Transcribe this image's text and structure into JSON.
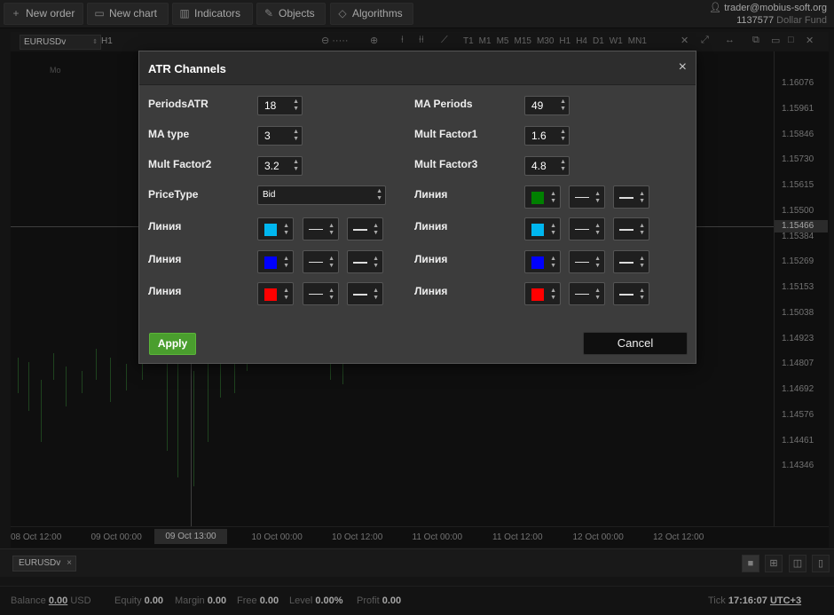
{
  "toolbar": {
    "new_order": "New order",
    "new_chart": "New chart",
    "indicators": "Indicators",
    "objects": "Objects",
    "algorithms": "Algorithms"
  },
  "account": {
    "user": "trader@mobius-soft.org",
    "number": "1137577",
    "fund": "Dollar Fund"
  },
  "chart_toolbar": {
    "symbol": "EURUSDv",
    "timeframe": "H1",
    "timeframes": [
      "T1",
      "M1",
      "M5",
      "M15",
      "M30",
      "H1",
      "H4",
      "D1",
      "W1",
      "MN1"
    ]
  },
  "chart": {
    "corner_label": "Mo",
    "y_labels": [
      "1.16076",
      "1.15961",
      "1.15846",
      "1.15730",
      "1.15615",
      "1.15500",
      "1.15384",
      "1.15269",
      "1.15153",
      "1.15038",
      "1.14923",
      "1.14807",
      "1.14692",
      "1.14576",
      "1.14461",
      "1.14346"
    ],
    "current_price": "1.15466",
    "x_labels": [
      "08 Oct 12:00",
      "09 Oct 00:00",
      "09 Oct 13:00",
      "10 Oct 00:00",
      "10 Oct 12:00",
      "11 Oct 00:00",
      "11 Oct 12:00",
      "12 Oct 00:00",
      "12 Oct 12:00"
    ]
  },
  "dialog": {
    "title": "ATR Channels",
    "close": "×",
    "fields": {
      "periods_atr": {
        "label": "PeriodsATR",
        "value": "18"
      },
      "ma_type": {
        "label": "MA type",
        "value": "3"
      },
      "mult_factor2": {
        "label": "Mult Factor2",
        "value": "3.2"
      },
      "price_type": {
        "label": "PriceType",
        "value": "Bid"
      },
      "ma_periods": {
        "label": "MA Periods",
        "value": "49"
      },
      "mult_factor1": {
        "label": "Mult Factor1",
        "value": "1.6"
      },
      "mult_factor3": {
        "label": "Mult Factor3",
        "value": "4.8"
      }
    },
    "lines_left": [
      {
        "label": "Линия",
        "color": "#00b7f0"
      },
      {
        "label": "Линия",
        "color": "#0000ff"
      },
      {
        "label": "Линия",
        "color": "#ff0000"
      }
    ],
    "lines_right": [
      {
        "label": "Линия",
        "color": "#008000"
      },
      {
        "label": "Линия",
        "color": "#00b7f0"
      },
      {
        "label": "Линия",
        "color": "#0000ff"
      },
      {
        "label": "Линия",
        "color": "#ff0000"
      }
    ],
    "apply": "Apply",
    "cancel": "Cancel"
  },
  "bottom": {
    "tab_symbol": "EURUSDv",
    "tab_close": "×"
  },
  "status": {
    "balance_label": "Balance",
    "balance_value": "0.00",
    "currency": "USD",
    "equity_label": "Equity",
    "equity_value": "0.00",
    "margin_label": "Margin",
    "margin_value": "0.00",
    "free_label": "Free",
    "free_value": "0.00",
    "level_label": "Level",
    "level_value": "0.00%",
    "profit_label": "Profit",
    "profit_value": "0.00",
    "tick_label": "Tick",
    "time": "17:16:07",
    "tz": "UTC+3"
  }
}
